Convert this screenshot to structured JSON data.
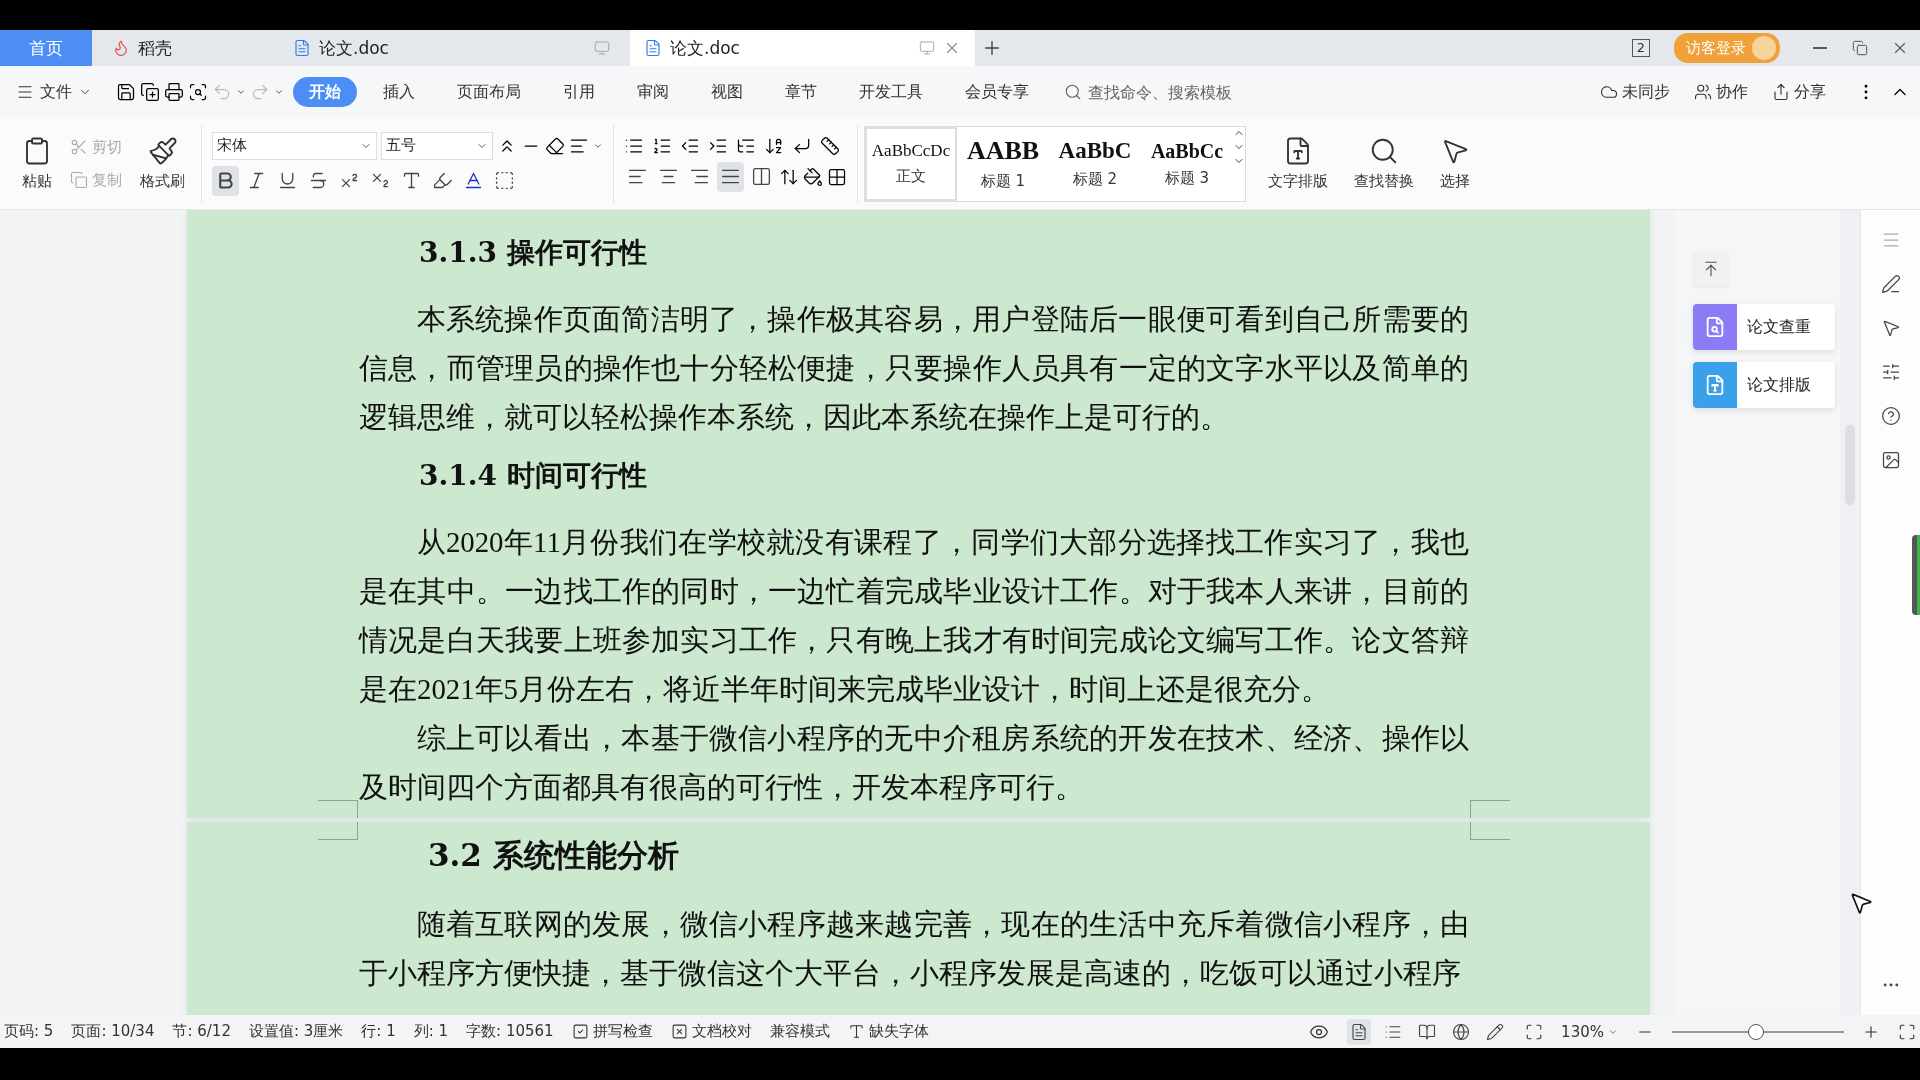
{
  "tabs": [
    {
      "label": "首页",
      "kind": "home",
      "selected": false
    },
    {
      "label": "稻壳",
      "kind": "app",
      "selected": false
    },
    {
      "label": "论文.doc",
      "kind": "doc",
      "selected": false
    },
    {
      "label": "论文.doc",
      "kind": "doc",
      "selected": true
    }
  ],
  "window_count": "2",
  "guest_login": "访客登录",
  "menu": {
    "file": "文件",
    "tabs": [
      {
        "label": "开始",
        "selected": true
      },
      {
        "label": "插入",
        "selected": false
      },
      {
        "label": "页面布局",
        "selected": false
      },
      {
        "label": "引用",
        "selected": false
      },
      {
        "label": "审阅",
        "selected": false
      },
      {
        "label": "视图",
        "selected": false
      },
      {
        "label": "章节",
        "selected": false
      },
      {
        "label": "开发工具",
        "selected": false
      },
      {
        "label": "会员专享",
        "selected": false
      }
    ],
    "search": {
      "placeholder": "查找命令、搜索模板"
    },
    "actions": [
      {
        "label": "未同步",
        "kind": "sync"
      },
      {
        "label": "协作",
        "kind": "collab"
      },
      {
        "label": "分享",
        "kind": "share"
      }
    ]
  },
  "ribbon": {
    "paste": "粘贴",
    "cut": "剪切",
    "copy": "复制",
    "format_painter": "格式刷",
    "font": "宋体",
    "size": "五号",
    "format_buttons": [
      {
        "kind": "bold",
        "selected": true
      },
      {
        "kind": "italic",
        "selected": false
      },
      {
        "kind": "underline",
        "selected": false
      },
      {
        "kind": "strike",
        "selected": false
      },
      {
        "kind": "superscript",
        "selected": false
      },
      {
        "kind": "subscript",
        "selected": false
      },
      {
        "kind": "effect",
        "selected": false
      },
      {
        "kind": "highlight",
        "selected": false
      },
      {
        "kind": "color",
        "selected": false
      },
      {
        "kind": "border",
        "selected": false
      }
    ],
    "align_buttons": [
      {
        "kind": "left",
        "selected": false
      },
      {
        "kind": "center",
        "selected": false
      },
      {
        "kind": "right",
        "selected": false
      },
      {
        "kind": "justify",
        "selected": true
      },
      {
        "kind": "distribute",
        "selected": false
      }
    ],
    "styles": [
      {
        "sample": "AaBbCcDc",
        "label": "正文",
        "kind": "body",
        "selected": true
      },
      {
        "sample": "AABB",
        "label": "标题 1",
        "kind": "h1",
        "selected": false
      },
      {
        "sample": "AaBbC",
        "label": "标题 2",
        "kind": "h2",
        "selected": false
      },
      {
        "sample": "AaBbCc",
        "label": "标题 3",
        "kind": "h3",
        "selected": false
      }
    ],
    "tools": [
      {
        "label": "文字排版",
        "kind": "layout"
      },
      {
        "label": "查找替换",
        "kind": "find"
      },
      {
        "label": "选择",
        "kind": "select"
      }
    ]
  },
  "document": {
    "pages": [
      {
        "blocks": [
          {
            "kind": "heading3",
            "text": "3.1.3  操作可行性"
          },
          {
            "kind": "paragraph",
            "text": "本系统操作页面简洁明了，操作极其容易，用户登陆后一眼便可看到自己所需要的信息，而管理员的操作也十分轻松便捷，只要操作人员具有一定的文字水平以及简单的逻辑思维，就可以轻松操作本系统，因此本系统在操作上是可行的。"
          },
          {
            "kind": "heading3",
            "text": "3.1.4 时间可行性"
          },
          {
            "kind": "paragraph",
            "text": "从2020年11月份我们在学校就没有课程了，同学们大部分选择找工作实习了，我也是在其中。一边找工作的同时，一边忙着完成毕业设计工作。对于我本人来讲，目前的情况是白天我要上班参加实习工作，只有晚上我才有时间完成论文编写工作。论文答辩是在2021年5月份左右，将近半年时间来完成毕业设计，时间上还是很充分。"
          },
          {
            "kind": "paragraph",
            "text": "综上可以看出，本基于微信小程序的无中介租房系统的开发在技术、经济、操作以及时间四个方面都具有很高的可行性，开发本程序可行。"
          }
        ]
      },
      {
        "blocks": [
          {
            "kind": "heading2",
            "text": "3.2  系统性能分析"
          },
          {
            "kind": "paragraph",
            "text": "随着互联网的发展，微信小程序越来越完善，现在的生活中充斥着微信小程序，由于小程序方便快捷，基于微信这个大平台，小程序发展是高速的，吃饭可以通过小程序"
          }
        ]
      }
    ]
  },
  "side_panel": {
    "items": [
      {
        "label": "论文查重",
        "kind": "check",
        "color": "#8b7cf6"
      },
      {
        "label": "论文排版",
        "kind": "layout",
        "color": "#3aa0ea"
      }
    ]
  },
  "status_bar": {
    "items": [
      "页码: 5",
      "页面: 10/34",
      "节: 6/12",
      "设置值: 3厘米",
      "行: 1",
      "列: 1",
      "字数: 10561"
    ],
    "tools": [
      {
        "label": "拼写检查",
        "kind": "spell"
      },
      {
        "label": "文档校对",
        "kind": "proof"
      },
      {
        "label": "兼容模式",
        "kind": "plain"
      },
      {
        "label": "缺失字体",
        "kind": "font"
      }
    ],
    "view_buttons": [
      {
        "kind": "page",
        "selected": true
      },
      {
        "kind": "outline",
        "selected": false
      },
      {
        "kind": "read",
        "selected": false
      },
      {
        "kind": "web",
        "selected": false
      },
      {
        "kind": "write",
        "selected": false
      }
    ],
    "zoom": {
      "reading": "130%",
      "level": 0.49
    }
  }
}
